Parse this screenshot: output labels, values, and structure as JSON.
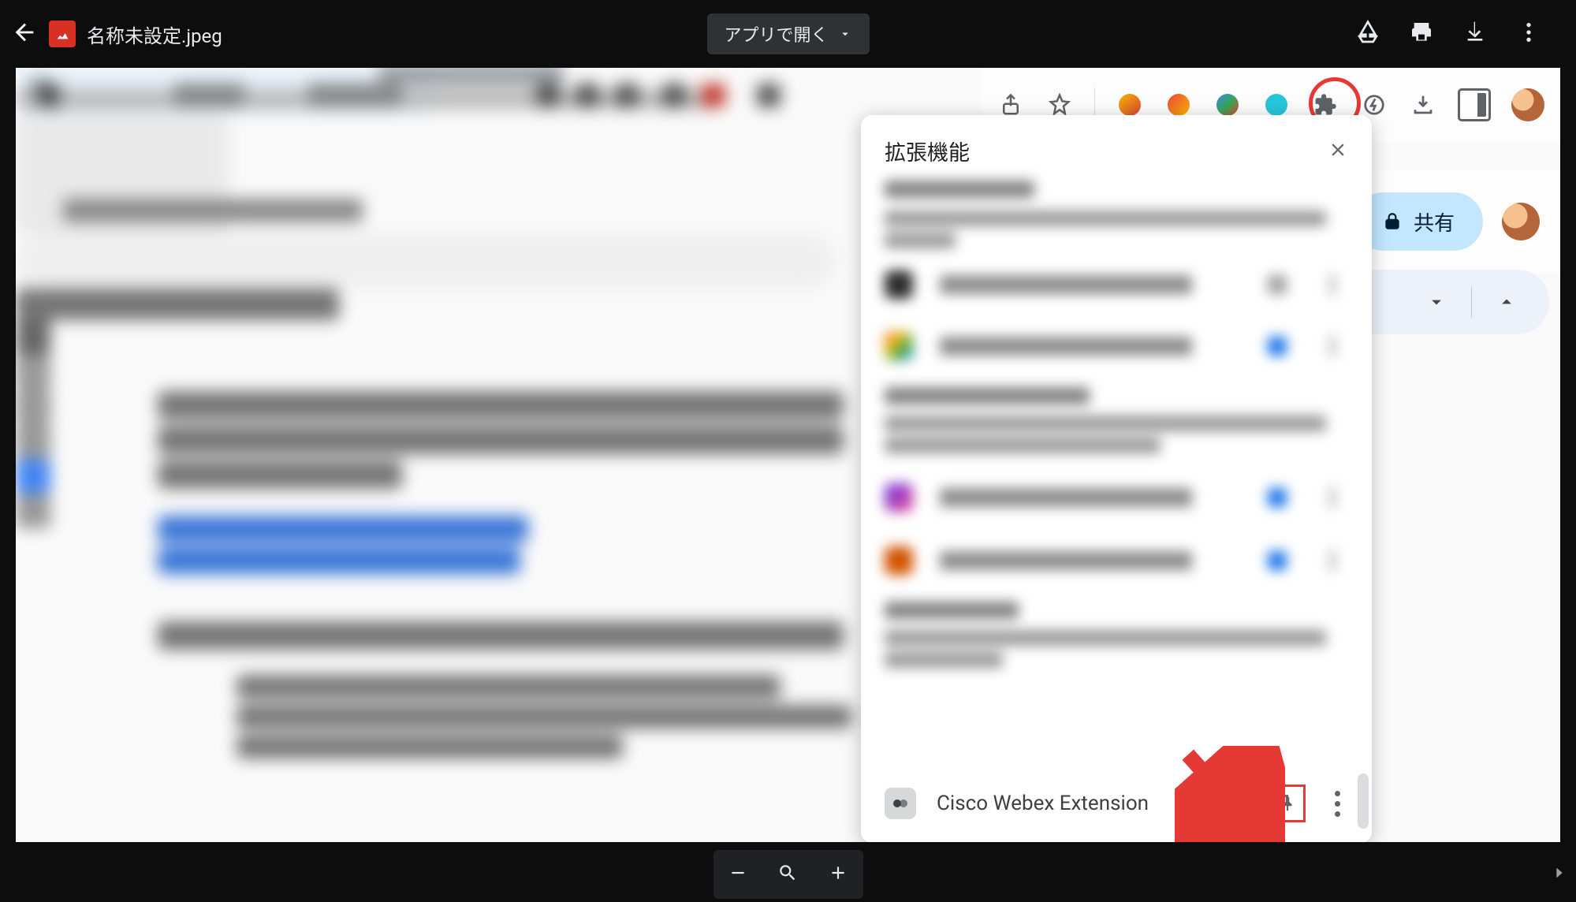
{
  "viewer": {
    "filename": "名称未設定.jpeg",
    "open_with_label": "アプリで開く"
  },
  "doc_right": {
    "share_label": "共有"
  },
  "ext_popup": {
    "title": "拡張機能",
    "cisco_label": "Cisco Webex Extension"
  }
}
